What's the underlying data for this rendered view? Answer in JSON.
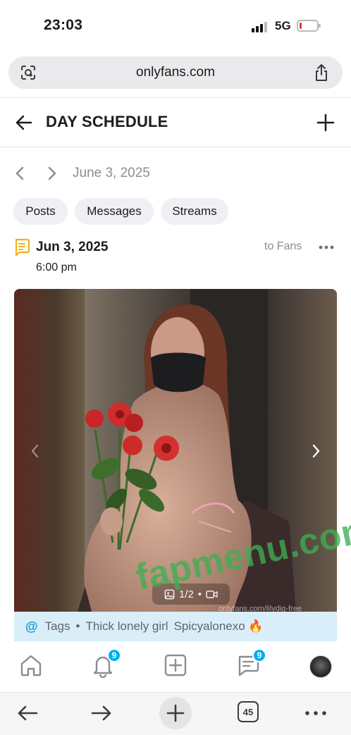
{
  "status_bar": {
    "time": "23:03",
    "network": "5G",
    "battery_level": 0.12,
    "battery_color": "#e53935"
  },
  "browser": {
    "url": "onlyfans.com"
  },
  "header": {
    "title": "DAY SCHEDULE"
  },
  "date_nav": {
    "date": "June 3, 2025"
  },
  "filters": [
    "Posts",
    "Messages",
    "Streams"
  ],
  "post": {
    "date": "Jun 3, 2025",
    "time": "6:00 pm",
    "audience": "to Fans",
    "media_counter": "1/2",
    "media_watermark": "onlyfans.com/lilydig-free",
    "tags_label": "Tags",
    "tags": [
      "Thick lonely girl",
      "Spicyalonexo 🔥"
    ]
  },
  "app_nav": {
    "notifications_badge": "9",
    "messages_badge": "9",
    "accent_color": "#00aff0"
  },
  "browser_bar": {
    "tab_count": "45"
  },
  "overlay_watermark": "fapmenu.com"
}
